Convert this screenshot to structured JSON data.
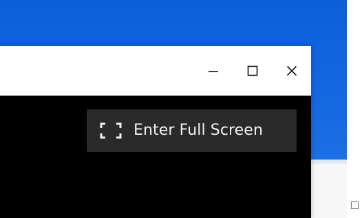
{
  "window": {
    "controls": {
      "minimize_icon": "minimize-icon",
      "maximize_icon": "maximize-icon",
      "close_icon": "close-icon"
    }
  },
  "video_overlay": {
    "fullscreen_button_label": "Enter Full Screen",
    "fullscreen_icon": "fullscreen-icon"
  },
  "colors": {
    "desktop_blue": "#1266df",
    "window_black": "#000000",
    "button_bg": "#2a2a2a",
    "button_text": "#f1f1f1"
  }
}
